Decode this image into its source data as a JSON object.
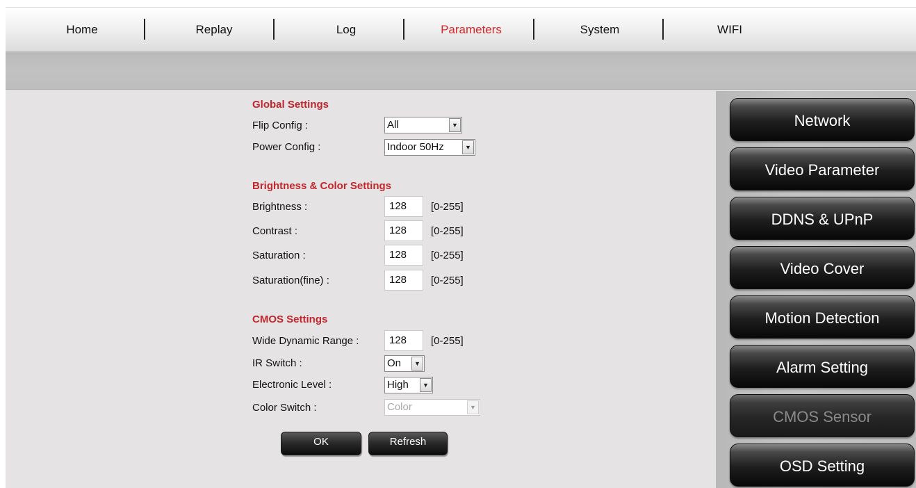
{
  "nav": {
    "items": [
      {
        "label": "Home",
        "active": false
      },
      {
        "label": "Replay",
        "active": false
      },
      {
        "label": "Log",
        "active": false
      },
      {
        "label": "Parameters",
        "active": true
      },
      {
        "label": "System",
        "active": false
      },
      {
        "label": "WIFI",
        "active": false
      }
    ],
    "active_color": "#d9262a"
  },
  "global": {
    "title": "Global Settings",
    "flip_label": "Flip Config :",
    "flip_value": "All",
    "power_label": "Power Config :",
    "power_value": "Indoor 50Hz"
  },
  "brightness": {
    "title": "Brightness & Color Settings",
    "rows": [
      {
        "label": "Brightness :",
        "value": "128",
        "range": "[0-255]"
      },
      {
        "label": "Contrast :",
        "value": "128",
        "range": "[0-255]"
      },
      {
        "label": "Saturation :",
        "value": "128",
        "range": "[0-255]"
      },
      {
        "label": "Saturation(fine) :",
        "value": "128",
        "range": "[0-255]"
      }
    ]
  },
  "cmos": {
    "title": "CMOS Settings",
    "wdr_label": "Wide Dynamic Range :",
    "wdr_value": "128",
    "wdr_range": "[0-255]",
    "ir_label": "IR Switch :",
    "ir_value": "On",
    "level_label": "Electronic Level :",
    "level_value": "High",
    "color_label": "Color Switch :",
    "color_value": "Color"
  },
  "buttons": {
    "ok": "OK",
    "refresh": "Refresh"
  },
  "sidebar": {
    "items": [
      {
        "label": "Network",
        "active": false
      },
      {
        "label": "Video Parameter",
        "active": false
      },
      {
        "label": "DDNS & UPnP",
        "active": false
      },
      {
        "label": "Video Cover",
        "active": false
      },
      {
        "label": "Motion Detection",
        "active": false
      },
      {
        "label": "Alarm Setting",
        "active": false
      },
      {
        "label": "CMOS Sensor",
        "active": true
      },
      {
        "label": "OSD Setting",
        "active": false
      }
    ]
  },
  "colors": {
    "section_title": "#c0262c",
    "content_bg": "#e5e3e4"
  }
}
